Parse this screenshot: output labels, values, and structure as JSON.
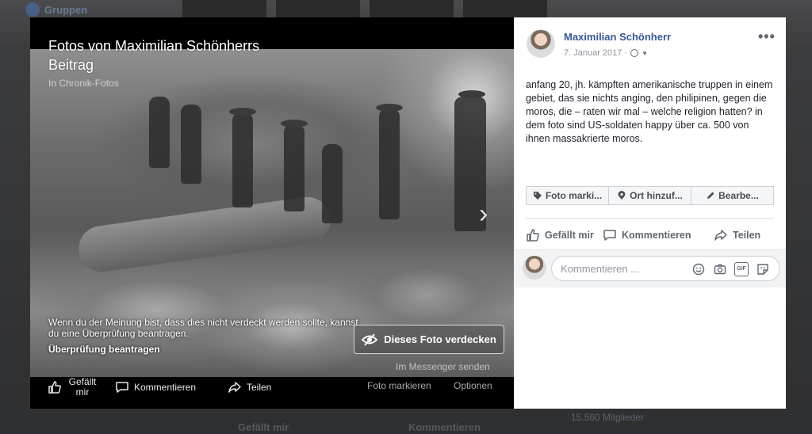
{
  "background": {
    "groups_label": "Gruppen",
    "members_label": "15.560 Mitglieder",
    "like_label": "Gefällt mir",
    "comment_label": "Kommentieren"
  },
  "theater": {
    "title": "Fotos von Maximilian Schönherrs Beitrag",
    "subtitle": "In Chronik-Fotos",
    "notice_text": "Wenn du der Meinung bist, dass dies nicht verdeckt werden sollte, kannst du eine Überprüfung beantragen.",
    "notice_link": "Überprüfung beantragen",
    "hide_button": "Dieses Foto verdecken",
    "messenger_link": "Im Messenger senden",
    "bottom": {
      "like": "Gefällt mir",
      "comment": "Kommentieren",
      "share": "Teilen",
      "tag_photo": "Foto markieren",
      "options": "Optionen"
    }
  },
  "panel": {
    "author": "Maximilian Schönherr",
    "date": "7. Januar 2017 ·",
    "more_icon": "more-dots-icon",
    "post_text": "anfang 20, jh. kämpften amerikanische truppen in einem gebiet, das sie nichts anging, den philipinen, gegen die moros, die – raten wir mal – welche religion hatten? in dem foto sind US-soldaten happy über ca. 500 von ihnen massakrierte moros.",
    "tag_buttons": [
      "Foto marki...",
      "Ort hinzuf...",
      "Bearbe..."
    ],
    "actions": {
      "like": "Gefällt mir",
      "comment": "Kommentieren",
      "share": "Teilen"
    },
    "comment_placeholder": "Kommentieren ..."
  },
  "colors": {
    "link_blue": "#385898",
    "panel_bg": "#ffffff",
    "theater_bg": "#000000"
  }
}
